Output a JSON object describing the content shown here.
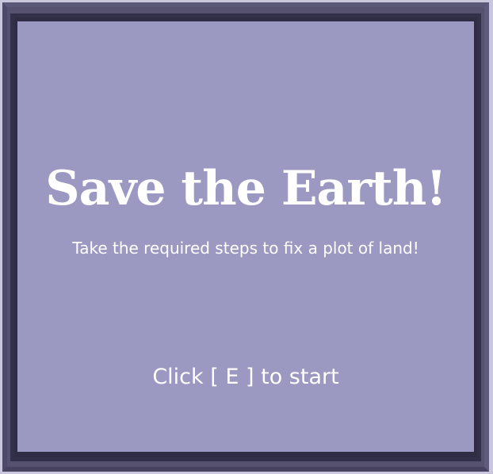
{
  "screen": {
    "title": "Save the Earth!",
    "subtitle": "Take the required steps to fix a plot of land!",
    "start_prompt": "Click [ E ] to start"
  },
  "colors": {
    "panel": "#9b98c1",
    "frame_dark": "#2f2c44",
    "frame_mid": "#55516f",
    "text": "#ffffff"
  }
}
